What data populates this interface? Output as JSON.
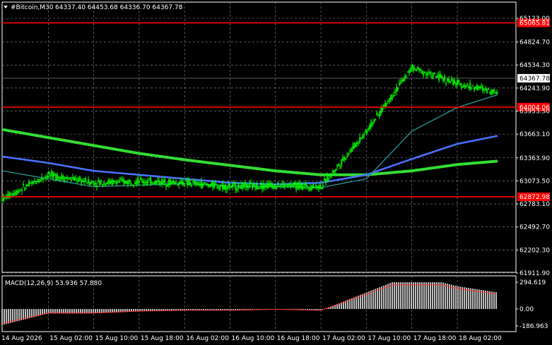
{
  "header": {
    "symbol": "#Bitcoin,M30",
    "ohlc": "64337.40 64453.68 64336.70 64367.78"
  },
  "macd": {
    "label": "MACD(12,26,9) 53.936 57.880",
    "scale_labels": [
      "294.619",
      "0.00",
      "-186.963"
    ],
    "scale_range": [
      -186.963,
      294.619
    ]
  },
  "price_axis": {
    "labels": [
      "65123.00",
      "64824.70",
      "64534.30",
      "64243.90",
      "63953.50",
      "63663.10",
      "63363.90",
      "63073.50",
      "62783.10",
      "62492.70",
      "62202.30",
      "61911.90"
    ],
    "range": [
      61911.9,
      65123.0
    ]
  },
  "time_axis": {
    "labels": [
      "14 Aug 2026",
      "15 Aug 02:00",
      "15 Aug 10:00",
      "15 Aug 18:00",
      "16 Aug 02:00",
      "16 Aug 10:00",
      "16 Aug 18:00",
      "17 Aug 02:00",
      "17 Aug 10:00",
      "17 Aug 18:00",
      "18 Aug 02:00"
    ]
  },
  "levels": [
    {
      "price": "65065.81",
      "value": 65065.81,
      "color": "#ff0000"
    },
    {
      "price": "64004.06",
      "value": 64004.06,
      "color": "#ff0000"
    },
    {
      "price": "62872.98",
      "value": 62872.98,
      "color": "#ff0000"
    }
  ],
  "current_price": {
    "label": "64367.78",
    "value": 64367.78
  },
  "colors": {
    "background": "#000000",
    "grid": "#8a8a8a",
    "candles": "#00ff00",
    "ma_fast": "#2a8f8f",
    "ma_mid": "#4a6fff",
    "ma_slow": "#33dd33",
    "macd_hist": "#bdbdbd",
    "macd_signal": "#ff3030",
    "level": "#ff0000"
  },
  "chart_data": {
    "type": "line",
    "x": [
      "14 Aug 2026",
      "15 Aug 02:00",
      "15 Aug 10:00",
      "15 Aug 18:00",
      "16 Aug 02:00",
      "16 Aug 10:00",
      "16 Aug 18:00",
      "17 Aug 02:00",
      "17 Aug 10:00",
      "17 Aug 18:00",
      "18 Aug 02:00"
    ],
    "series": [
      {
        "values": [
          62850,
          63150,
          63050,
          63070,
          63050,
          63000,
          63020,
          63000,
          63700,
          64500,
          64300
        ]
      },
      {
        "values": [
          63200,
          63100,
          63000,
          63020,
          63040,
          63010,
          63000,
          62990,
          63100,
          63700,
          64000
        ]
      },
      {
        "values": [
          63380,
          63300,
          63200,
          63150,
          63100,
          63050,
          63030,
          63050,
          63150,
          63350,
          63540
        ]
      },
      {
        "values": [
          63720,
          63620,
          63520,
          63420,
          63340,
          63270,
          63200,
          63150,
          63150,
          63200,
          63280
        ]
      }
    ],
    "ylim": [
      61911.9,
      65123.0
    ]
  }
}
